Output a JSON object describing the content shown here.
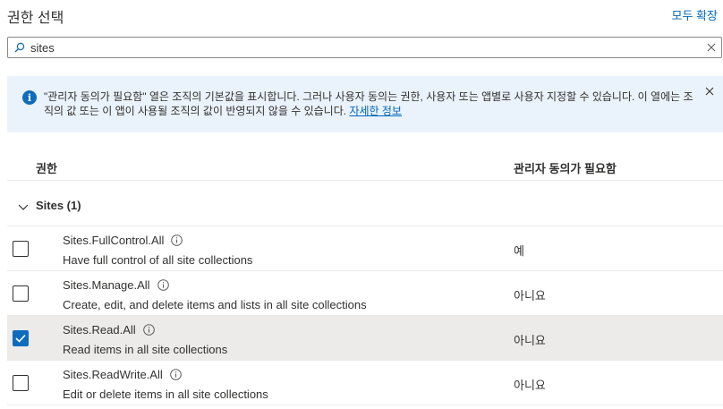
{
  "header": {
    "title": "권한 선택",
    "expand_all": "모두 확장"
  },
  "search": {
    "value": "sites"
  },
  "info": {
    "message": "\"관리자 동의가 필요함\" 열은 조직의 기본값을 표시합니다. 그러나 사용자 동의는 권한, 사용자 또는 앱별로 사용자 지정할 수 있습니다. 이 열에는 조직의 값 또는 이 앱이 사용될 조직의 값이 반영되지 않을 수 있습니다.",
    "link": "자세한 정보"
  },
  "columns": {
    "permission": "권한",
    "admin_consent": "관리자 동의가 필요함"
  },
  "group": {
    "title": "Sites (1)"
  },
  "rows": [
    {
      "name": "Sites.FullControl.All",
      "description": "Have full control of all site collections",
      "admin": "예",
      "checked": false
    },
    {
      "name": "Sites.Manage.All",
      "description": "Create, edit, and delete items and lists in all site collections",
      "admin": "아니요",
      "checked": false
    },
    {
      "name": "Sites.Read.All",
      "description": "Read items in all site collections",
      "admin": "아니요",
      "checked": true
    },
    {
      "name": "Sites.ReadWrite.All",
      "description": "Edit or delete items in all site collections",
      "admin": "아니요",
      "checked": false
    }
  ],
  "colors": {
    "accent": "#0f6cbd",
    "link": "#0067b8",
    "info_bg": "#eaf2fb",
    "selected_row": "#edebe9"
  }
}
